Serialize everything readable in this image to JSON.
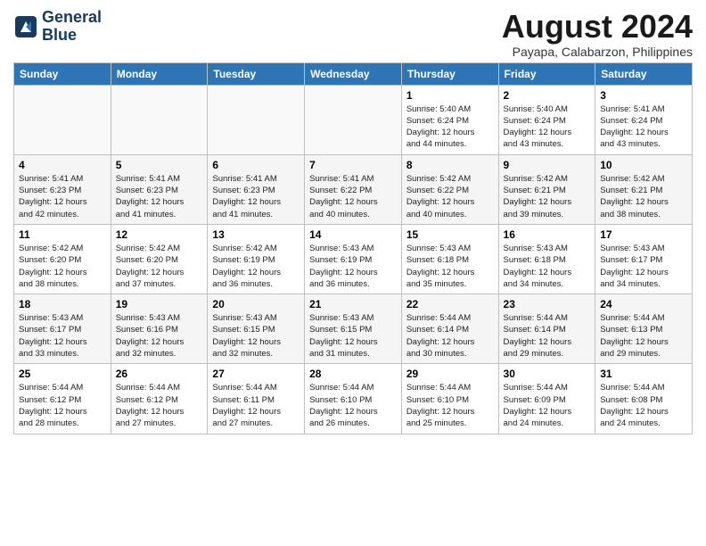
{
  "logo": {
    "line1": "General",
    "line2": "Blue"
  },
  "title": "August 2024",
  "location": "Payapa, Calabarzon, Philippines",
  "days_of_week": [
    "Sunday",
    "Monday",
    "Tuesday",
    "Wednesday",
    "Thursday",
    "Friday",
    "Saturday"
  ],
  "weeks": [
    [
      {
        "day": "",
        "info": ""
      },
      {
        "day": "",
        "info": ""
      },
      {
        "day": "",
        "info": ""
      },
      {
        "day": "",
        "info": ""
      },
      {
        "day": "1",
        "info": "Sunrise: 5:40 AM\nSunset: 6:24 PM\nDaylight: 12 hours\nand 44 minutes."
      },
      {
        "day": "2",
        "info": "Sunrise: 5:40 AM\nSunset: 6:24 PM\nDaylight: 12 hours\nand 43 minutes."
      },
      {
        "day": "3",
        "info": "Sunrise: 5:41 AM\nSunset: 6:24 PM\nDaylight: 12 hours\nand 43 minutes."
      }
    ],
    [
      {
        "day": "4",
        "info": "Sunrise: 5:41 AM\nSunset: 6:23 PM\nDaylight: 12 hours\nand 42 minutes."
      },
      {
        "day": "5",
        "info": "Sunrise: 5:41 AM\nSunset: 6:23 PM\nDaylight: 12 hours\nand 41 minutes."
      },
      {
        "day": "6",
        "info": "Sunrise: 5:41 AM\nSunset: 6:23 PM\nDaylight: 12 hours\nand 41 minutes."
      },
      {
        "day": "7",
        "info": "Sunrise: 5:41 AM\nSunset: 6:22 PM\nDaylight: 12 hours\nand 40 minutes."
      },
      {
        "day": "8",
        "info": "Sunrise: 5:42 AM\nSunset: 6:22 PM\nDaylight: 12 hours\nand 40 minutes."
      },
      {
        "day": "9",
        "info": "Sunrise: 5:42 AM\nSunset: 6:21 PM\nDaylight: 12 hours\nand 39 minutes."
      },
      {
        "day": "10",
        "info": "Sunrise: 5:42 AM\nSunset: 6:21 PM\nDaylight: 12 hours\nand 38 minutes."
      }
    ],
    [
      {
        "day": "11",
        "info": "Sunrise: 5:42 AM\nSunset: 6:20 PM\nDaylight: 12 hours\nand 38 minutes."
      },
      {
        "day": "12",
        "info": "Sunrise: 5:42 AM\nSunset: 6:20 PM\nDaylight: 12 hours\nand 37 minutes."
      },
      {
        "day": "13",
        "info": "Sunrise: 5:42 AM\nSunset: 6:19 PM\nDaylight: 12 hours\nand 36 minutes."
      },
      {
        "day": "14",
        "info": "Sunrise: 5:43 AM\nSunset: 6:19 PM\nDaylight: 12 hours\nand 36 minutes."
      },
      {
        "day": "15",
        "info": "Sunrise: 5:43 AM\nSunset: 6:18 PM\nDaylight: 12 hours\nand 35 minutes."
      },
      {
        "day": "16",
        "info": "Sunrise: 5:43 AM\nSunset: 6:18 PM\nDaylight: 12 hours\nand 34 minutes."
      },
      {
        "day": "17",
        "info": "Sunrise: 5:43 AM\nSunset: 6:17 PM\nDaylight: 12 hours\nand 34 minutes."
      }
    ],
    [
      {
        "day": "18",
        "info": "Sunrise: 5:43 AM\nSunset: 6:17 PM\nDaylight: 12 hours\nand 33 minutes."
      },
      {
        "day": "19",
        "info": "Sunrise: 5:43 AM\nSunset: 6:16 PM\nDaylight: 12 hours\nand 32 minutes."
      },
      {
        "day": "20",
        "info": "Sunrise: 5:43 AM\nSunset: 6:15 PM\nDaylight: 12 hours\nand 32 minutes."
      },
      {
        "day": "21",
        "info": "Sunrise: 5:43 AM\nSunset: 6:15 PM\nDaylight: 12 hours\nand 31 minutes."
      },
      {
        "day": "22",
        "info": "Sunrise: 5:44 AM\nSunset: 6:14 PM\nDaylight: 12 hours\nand 30 minutes."
      },
      {
        "day": "23",
        "info": "Sunrise: 5:44 AM\nSunset: 6:14 PM\nDaylight: 12 hours\nand 29 minutes."
      },
      {
        "day": "24",
        "info": "Sunrise: 5:44 AM\nSunset: 6:13 PM\nDaylight: 12 hours\nand 29 minutes."
      }
    ],
    [
      {
        "day": "25",
        "info": "Sunrise: 5:44 AM\nSunset: 6:12 PM\nDaylight: 12 hours\nand 28 minutes."
      },
      {
        "day": "26",
        "info": "Sunrise: 5:44 AM\nSunset: 6:12 PM\nDaylight: 12 hours\nand 27 minutes."
      },
      {
        "day": "27",
        "info": "Sunrise: 5:44 AM\nSunset: 6:11 PM\nDaylight: 12 hours\nand 27 minutes."
      },
      {
        "day": "28",
        "info": "Sunrise: 5:44 AM\nSunset: 6:10 PM\nDaylight: 12 hours\nand 26 minutes."
      },
      {
        "day": "29",
        "info": "Sunrise: 5:44 AM\nSunset: 6:10 PM\nDaylight: 12 hours\nand 25 minutes."
      },
      {
        "day": "30",
        "info": "Sunrise: 5:44 AM\nSunset: 6:09 PM\nDaylight: 12 hours\nand 24 minutes."
      },
      {
        "day": "31",
        "info": "Sunrise: 5:44 AM\nSunset: 6:08 PM\nDaylight: 12 hours\nand 24 minutes."
      }
    ]
  ]
}
